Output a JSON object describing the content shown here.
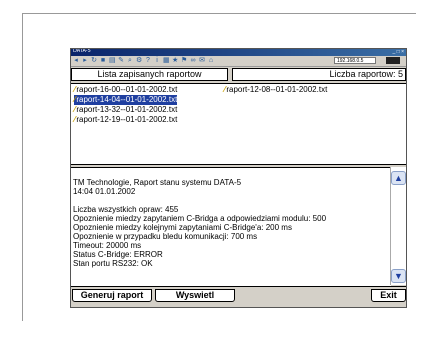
{
  "window": {
    "title": "DATA-5",
    "controls": "_ □ ×",
    "ip_address": "192.168.0.5"
  },
  "toolbar": {
    "icons": [
      "back-icon",
      "forward-icon",
      "refresh-icon",
      "save-icon",
      "print-icon",
      "tool-icon",
      "find-icon",
      "settings-icon",
      "help-icon",
      "info-icon",
      "grid-icon",
      "star-icon",
      "flag-icon",
      "link-icon",
      "mail-icon",
      "home-icon"
    ]
  },
  "headers": {
    "list_title": "Lista zapisanych raportow",
    "count_label": "Liczba raportow: 5"
  },
  "files": [
    {
      "name": "raport-16-00--01-01-2002.txt",
      "selected": false
    },
    {
      "name": "raport-14-04--01-01-2002.txt",
      "selected": true
    },
    {
      "name": "raport-13-32--01-01-2002.txt",
      "selected": false
    },
    {
      "name": "raport-12-19--01-01-2002.txt",
      "selected": false
    },
    {
      "name": "raport-12-08--01-01-2002.txt",
      "selected": false
    }
  ],
  "report": {
    "lines": [
      "TM Technologie, Raport stanu systemu DATA-5",
      "14:04  01.01.2002",
      "",
      "Liczba wszystkich opraw: 455",
      "Opoznienie miedzy zapytaniem C-Bridga a odpowiedziami modulu: 500",
      "Opoznienie miedzy kolejnymi zapytaniami C-Bridge'a: 200 ms",
      "Opoznienie w przypadku bledu komunikacji: 700 ms",
      "Timeout: 20000 ms",
      "Status C-Bridge: ERROR",
      "Stan portu RS232: OK"
    ]
  },
  "buttons": {
    "generate": "Generuj raport",
    "show": "Wyswietl",
    "exit": "Exit"
  },
  "colors": {
    "selection": "#1f3fa0",
    "file_icon": "#c8a000",
    "window_bg": "#d4d0c8"
  }
}
